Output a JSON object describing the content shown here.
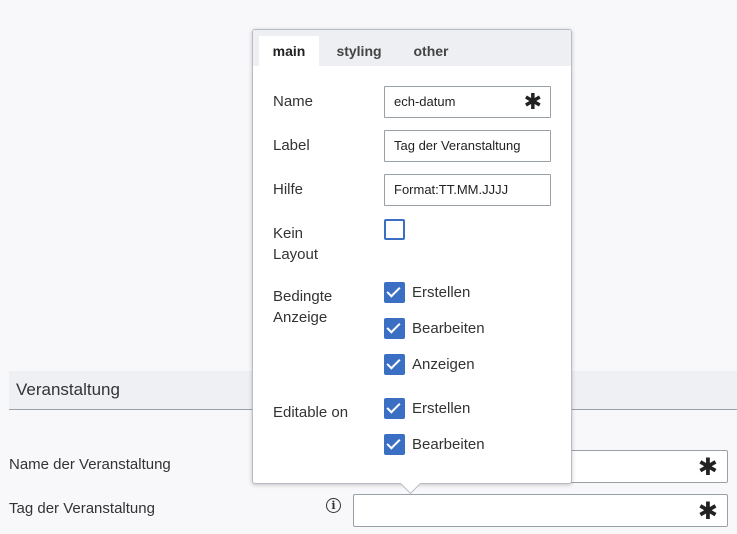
{
  "section": {
    "title": "Veranstaltung"
  },
  "form": {
    "fields": [
      {
        "label": "Name der Veranstaltung",
        "required_marker": "✱"
      },
      {
        "label": "Tag der Veranstaltung",
        "required_marker": "✱",
        "info_icon": "i"
      }
    ]
  },
  "popover": {
    "tabs": [
      {
        "label": "main",
        "active": true
      },
      {
        "label": "styling",
        "active": false
      },
      {
        "label": "other",
        "active": false
      }
    ],
    "name": {
      "label": "Name",
      "value": "ech-datum",
      "required_marker": "✱"
    },
    "label_field": {
      "label": "Label",
      "value": "Tag der Veranstaltung"
    },
    "hilfe": {
      "label": "Hilfe",
      "value": "Format:TT.MM.JJJJ"
    },
    "kein_layout": {
      "label_line1": "Kein",
      "label_line2": "Layout",
      "checked": false
    },
    "bedingte_anzeige": {
      "label_line1": "Bedingte",
      "label_line2": "Anzeige",
      "options": [
        {
          "label": "Erstellen",
          "checked": true
        },
        {
          "label": "Bearbeiten",
          "checked": true
        },
        {
          "label": "Anzeigen",
          "checked": true
        }
      ]
    },
    "editable_on": {
      "label": "Editable on",
      "options": [
        {
          "label": "Erstellen",
          "checked": true
        },
        {
          "label": "Bearbeiten",
          "checked": true
        }
      ]
    }
  },
  "colors": {
    "accent": "#3b6fc4",
    "border": "#9aa0a8",
    "background": "#f8f8fa"
  }
}
